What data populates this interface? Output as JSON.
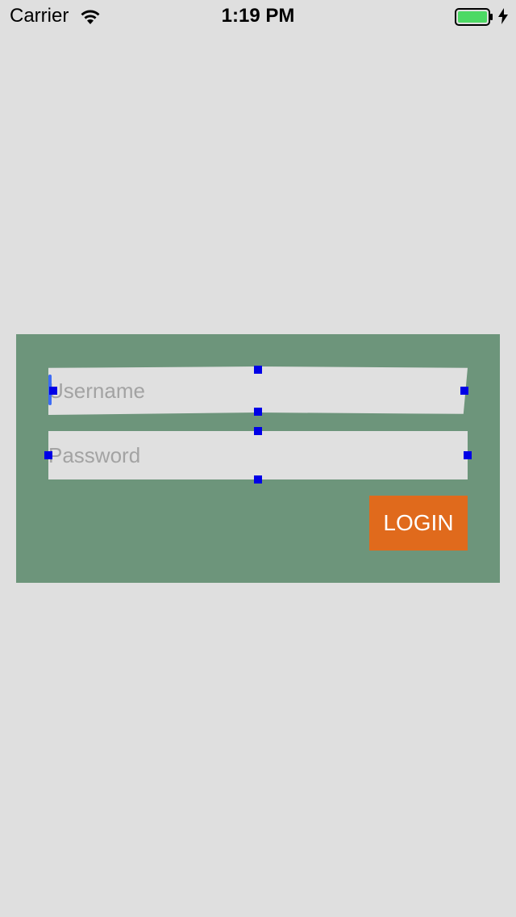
{
  "status_bar": {
    "carrier": "Carrier",
    "time": "1:19 PM",
    "wifi_icon": "wifi-icon",
    "battery_icon": "battery-icon",
    "charging_icon": "bolt-icon",
    "battery_color": "#4cd964"
  },
  "login": {
    "panel_color": "#6d957b",
    "username": {
      "placeholder": "Username",
      "value": ""
    },
    "password": {
      "placeholder": "Password",
      "value": ""
    },
    "button_label": "LOGIN",
    "button_color": "#e06a1c",
    "handle_color": "#0000e6",
    "caret_color": "#3d6cf5"
  }
}
